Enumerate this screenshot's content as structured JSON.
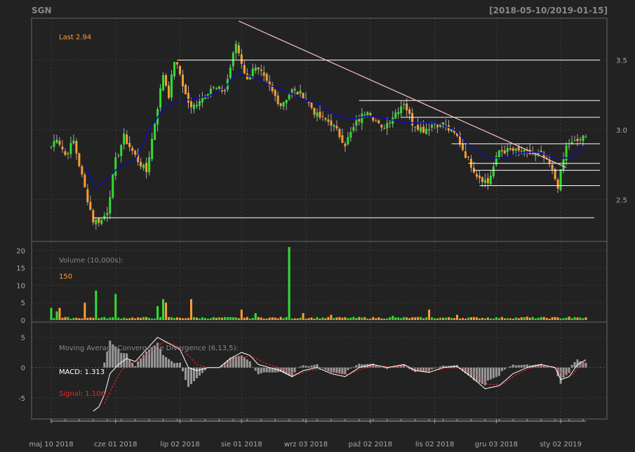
{
  "header": {
    "symbol": "SGN",
    "range": "[2018-05-10/2019-01-15]"
  },
  "colors": {
    "bg": "#222222",
    "frame": "#666666",
    "grid": "#3c3c3c",
    "text": "#aaaaaa",
    "up": "#33dd33",
    "down": "#ff9d30",
    "ma": "#1010aa",
    "macd": "#ffffff",
    "signal": "#ff2020",
    "hist": "#999999",
    "level": "#ffffff",
    "trend": "#ffc0c8"
  },
  "chart_data": [
    {
      "type": "candlestick",
      "name": "price",
      "last_label": "Last 2.94",
      "ylim": [
        2.2,
        3.8
      ],
      "yticks": [
        "2.5",
        "3.0",
        "3.5"
      ],
      "xticks": [
        "maj 10 2018",
        "cze 01 2018",
        "lip 02 2018",
        "sie 01 2018",
        "wrz 03 2018",
        "paź 02 2018",
        "lis 02 2018",
        "gru 03 2018",
        "sty 02 2019"
      ],
      "close_anchors": [
        [
          0,
          2.88
        ],
        [
          2,
          2.95
        ],
        [
          5,
          2.82
        ],
        [
          8,
          2.92
        ],
        [
          12,
          2.58
        ],
        [
          15,
          2.35
        ],
        [
          18,
          2.35
        ],
        [
          20,
          2.42
        ],
        [
          23,
          2.78
        ],
        [
          26,
          2.95
        ],
        [
          28,
          2.88
        ],
        [
          31,
          2.78
        ],
        [
          34,
          2.7
        ],
        [
          37,
          3.05
        ],
        [
          40,
          3.4
        ],
        [
          42,
          3.25
        ],
        [
          44,
          3.5
        ],
        [
          46,
          3.4
        ],
        [
          48,
          3.25
        ],
        [
          50,
          3.15
        ],
        [
          53,
          3.22
        ],
        [
          57,
          3.3
        ],
        [
          62,
          3.28
        ],
        [
          66,
          3.62
        ],
        [
          70,
          3.35
        ],
        [
          72,
          3.45
        ],
        [
          75,
          3.4
        ],
        [
          78,
          3.3
        ],
        [
          82,
          3.18
        ],
        [
          86,
          3.28
        ],
        [
          90,
          3.25
        ],
        [
          95,
          3.1
        ],
        [
          100,
          3.05
        ],
        [
          105,
          2.9
        ],
        [
          109,
          3.05
        ],
        [
          113,
          3.15
        ],
        [
          118,
          3.0
        ],
        [
          122,
          3.1
        ],
        [
          126,
          3.2
        ],
        [
          129,
          3.05
        ],
        [
          133,
          3.0
        ],
        [
          137,
          3.05
        ],
        [
          141,
          3.02
        ],
        [
          145,
          2.95
        ],
        [
          148,
          2.82
        ],
        [
          152,
          2.68
        ],
        [
          156,
          2.62
        ],
        [
          160,
          2.85
        ],
        [
          165,
          2.85
        ],
        [
          170,
          2.83
        ],
        [
          175,
          2.82
        ],
        [
          178,
          2.75
        ],
        [
          181,
          2.6
        ],
        [
          184,
          2.88
        ],
        [
          186,
          2.9
        ],
        [
          190,
          2.94
        ]
      ],
      "ma_anchors": [
        [
          12,
          2.75
        ],
        [
          16,
          2.58
        ],
        [
          20,
          2.65
        ],
        [
          25,
          2.75
        ],
        [
          30,
          2.78
        ],
        [
          35,
          3.0
        ],
        [
          40,
          3.15
        ],
        [
          45,
          3.2
        ],
        [
          50,
          3.22
        ],
        [
          56,
          3.24
        ],
        [
          62,
          3.3
        ],
        [
          66,
          3.4
        ],
        [
          72,
          3.38
        ],
        [
          78,
          3.32
        ],
        [
          84,
          3.28
        ],
        [
          90,
          3.22
        ],
        [
          96,
          3.18
        ],
        [
          102,
          3.1
        ],
        [
          108,
          3.08
        ],
        [
          114,
          3.1
        ],
        [
          120,
          3.08
        ],
        [
          126,
          3.05
        ],
        [
          132,
          3.05
        ],
        [
          138,
          3.05
        ],
        [
          144,
          3.0
        ],
        [
          150,
          2.88
        ],
        [
          156,
          2.8
        ],
        [
          162,
          2.8
        ],
        [
          168,
          2.84
        ],
        [
          174,
          2.84
        ],
        [
          180,
          2.8
        ],
        [
          186,
          2.8
        ],
        [
          190,
          2.88
        ]
      ],
      "support_resistance": [
        {
          "level": 3.5,
          "from": 45,
          "to": 191
        },
        {
          "level": 3.21,
          "from": 110,
          "to": 191
        },
        {
          "level": 3.09,
          "from": 125,
          "to": 191
        },
        {
          "level": 2.9,
          "from": 143,
          "to": 191
        },
        {
          "level": 2.76,
          "from": 149,
          "to": 191
        },
        {
          "level": 2.71,
          "from": 151,
          "to": 191
        },
        {
          "level": 2.6,
          "from": 153,
          "to": 191
        },
        {
          "level": 2.37,
          "from": 15,
          "to": 189
        }
      ],
      "trendline": {
        "from": [
          67,
          3.78
        ],
        "to": [
          184,
          2.73
        ]
      }
    },
    {
      "type": "bar",
      "name": "volume",
      "title": "Volume (10,000s):",
      "last_label": "150",
      "ylim": [
        0,
        22
      ],
      "yticks": [
        "0",
        "5",
        "10",
        "15",
        "20"
      ],
      "spikes": [
        [
          0,
          3.5
        ],
        [
          2,
          2.5
        ],
        [
          3,
          3.5
        ],
        [
          12,
          5
        ],
        [
          16,
          8.5
        ],
        [
          23,
          7.5
        ],
        [
          38,
          4
        ],
        [
          40,
          6
        ],
        [
          41,
          5
        ],
        [
          50,
          6
        ],
        [
          68,
          3
        ],
        [
          73,
          2
        ],
        [
          85,
          21
        ],
        [
          90,
          2
        ],
        [
          100,
          1.5
        ],
        [
          122,
          1.2
        ],
        [
          135,
          3
        ],
        [
          145,
          1.5
        ],
        [
          170,
          1
        ],
        [
          185,
          1
        ]
      ],
      "base": 0.4
    },
    {
      "type": "line",
      "name": "macd",
      "title": "Moving Average Convergence Divergence (6,13,5):",
      "macd_label": "MACD: 1.313",
      "signal_label": "Signal: 1.106",
      "ylim": [
        -8.5,
        7.5
      ],
      "yticks": [
        "-5",
        "0",
        "5"
      ],
      "macd_anchors": [
        [
          15,
          -7.2
        ],
        [
          17,
          -6.5
        ],
        [
          19,
          -4.5
        ],
        [
          21,
          -1
        ],
        [
          24,
          0.5
        ],
        [
          27,
          1.5
        ],
        [
          30,
          1
        ],
        [
          33,
          2.5
        ],
        [
          36,
          4.0
        ],
        [
          38,
          5.0
        ],
        [
          42,
          4.0
        ],
        [
          46,
          3.0
        ],
        [
          49,
          0
        ],
        [
          52,
          -0.5
        ],
        [
          56,
          0
        ],
        [
          60,
          0
        ],
        [
          64,
          1.5
        ],
        [
          68,
          2.5
        ],
        [
          71,
          2.0
        ],
        [
          74,
          0.5
        ],
        [
          78,
          0
        ],
        [
          82,
          -0.5
        ],
        [
          86,
          -1.5
        ],
        [
          90,
          -0.5
        ],
        [
          95,
          0
        ],
        [
          100,
          -1.0
        ],
        [
          105,
          -1.5
        ],
        [
          110,
          0
        ],
        [
          115,
          0.5
        ],
        [
          120,
          0
        ],
        [
          126,
          0.5
        ],
        [
          130,
          -0.5
        ],
        [
          135,
          -0.8
        ],
        [
          140,
          0
        ],
        [
          145,
          0.2
        ],
        [
          150,
          -1.5
        ],
        [
          155,
          -3.5
        ],
        [
          160,
          -3.0
        ],
        [
          165,
          -1.0
        ],
        [
          170,
          0
        ],
        [
          175,
          0.5
        ],
        [
          180,
          0
        ],
        [
          182,
          -2.0
        ],
        [
          185,
          -1.5
        ],
        [
          188,
          0.5
        ],
        [
          191,
          1.3
        ]
      ],
      "signal_anchors": [
        [
          19,
          -6.0
        ],
        [
          22,
          -3.0
        ],
        [
          25,
          -0.5
        ],
        [
          28,
          0.8
        ],
        [
          31,
          1.2
        ],
        [
          34,
          2.0
        ],
        [
          37,
          3.2
        ],
        [
          40,
          4.2
        ],
        [
          44,
          3.8
        ],
        [
          48,
          2.5
        ],
        [
          52,
          0.5
        ],
        [
          56,
          0
        ],
        [
          60,
          0
        ],
        [
          64,
          0.8
        ],
        [
          68,
          1.8
        ],
        [
          72,
          1.8
        ],
        [
          76,
          0.8
        ],
        [
          80,
          0.2
        ],
        [
          84,
          -0.5
        ],
        [
          88,
          -1.2
        ],
        [
          92,
          -0.5
        ],
        [
          96,
          -0.3
        ],
        [
          101,
          -0.8
        ],
        [
          106,
          -1.2
        ],
        [
          111,
          -0.2
        ],
        [
          116,
          0.3
        ],
        [
          121,
          0.1
        ],
        [
          127,
          0.3
        ],
        [
          131,
          -0.3
        ],
        [
          136,
          -0.6
        ],
        [
          141,
          -0.1
        ],
        [
          146,
          0
        ],
        [
          151,
          -1.0
        ],
        [
          156,
          -2.8
        ],
        [
          161,
          -2.8
        ],
        [
          166,
          -1.2
        ],
        [
          171,
          -0.1
        ],
        [
          176,
          0.3
        ],
        [
          180,
          0.1
        ],
        [
          183,
          -1.2
        ],
        [
          186,
          -1.3
        ],
        [
          189,
          0.3
        ],
        [
          191,
          1.1
        ]
      ]
    }
  ]
}
